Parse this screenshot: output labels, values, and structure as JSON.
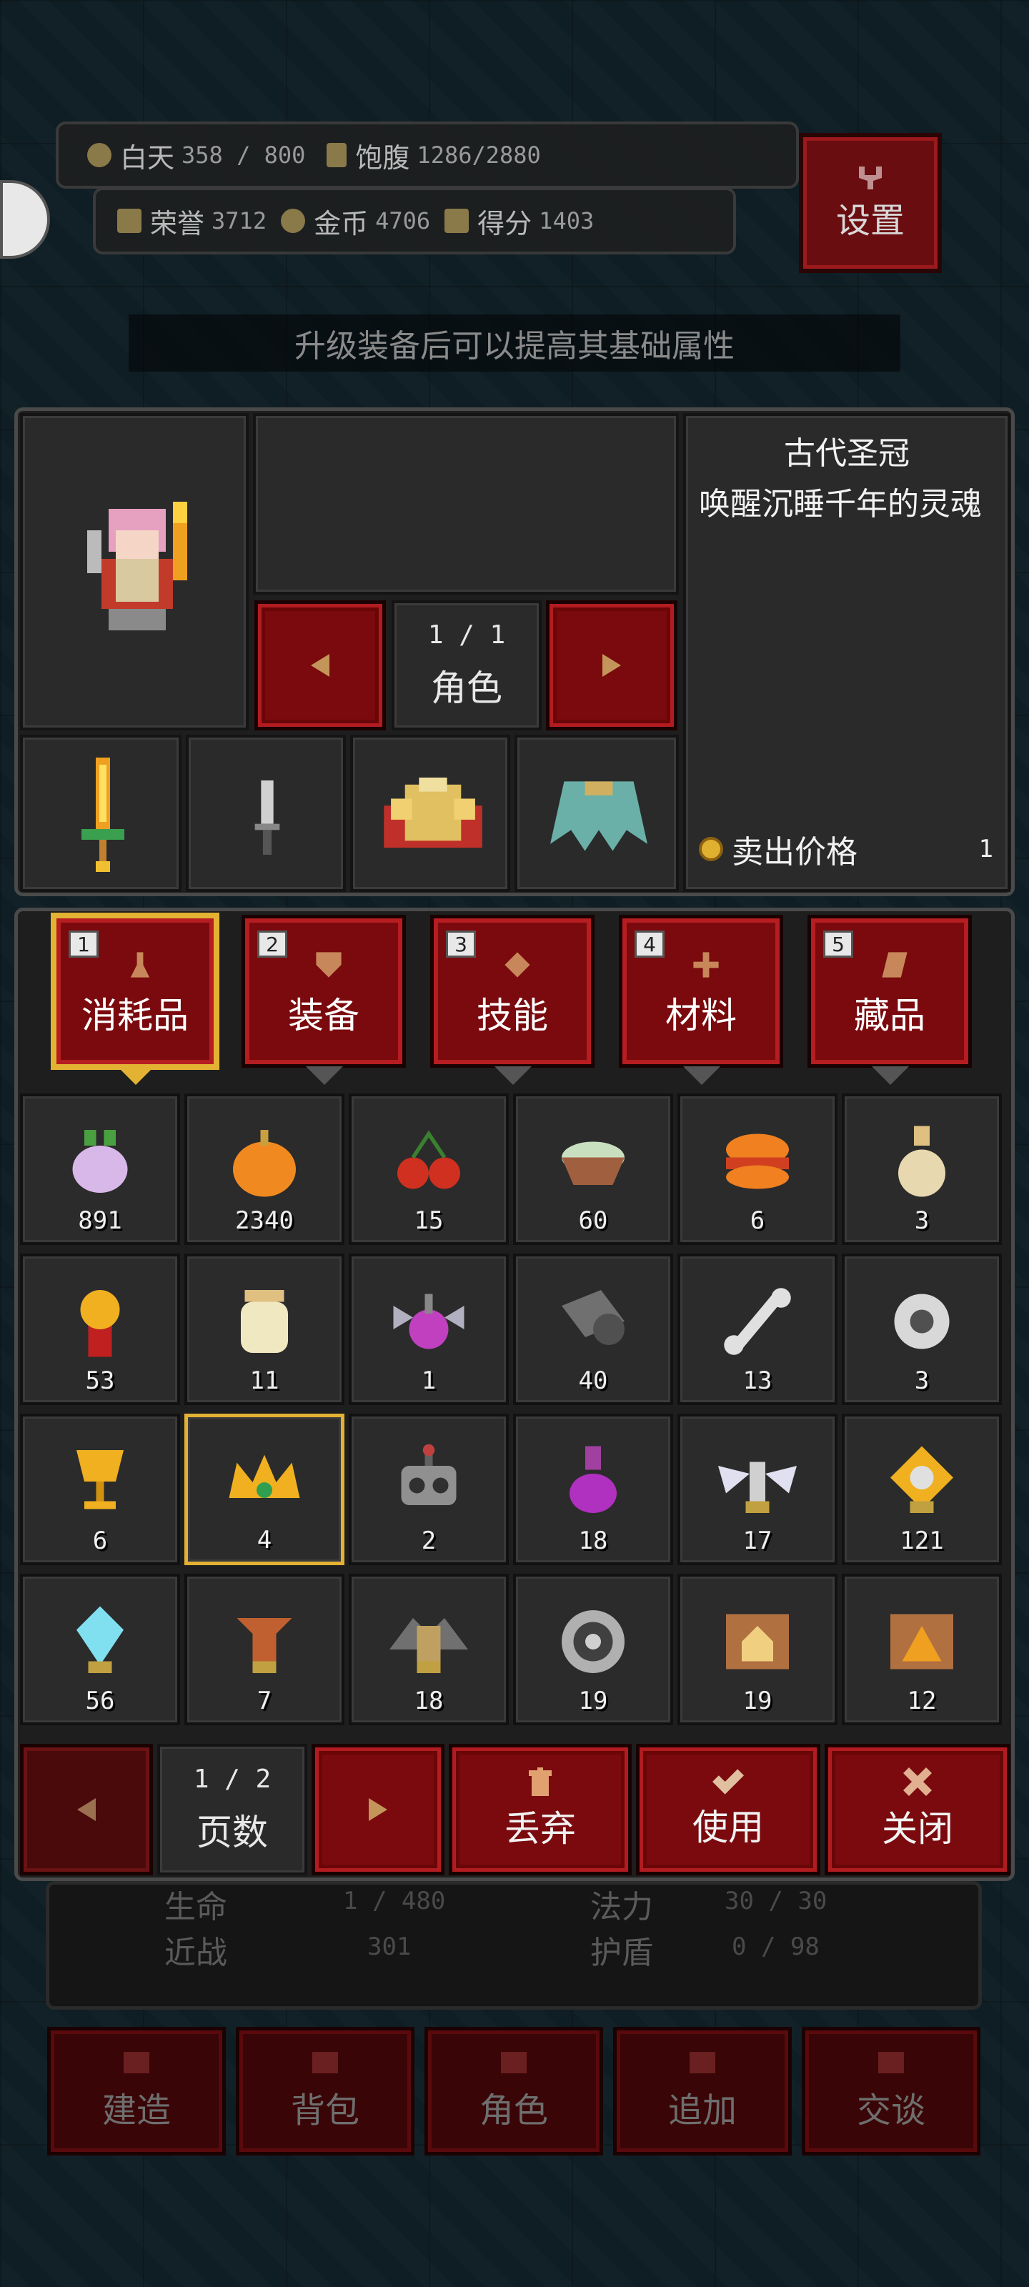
{
  "hud": {
    "day_label": "白天",
    "day_value": "358 / 800",
    "satiety_label": "饱腹",
    "satiety_value": "1286/2880",
    "honor_label": "荣誉",
    "honor_value": "3712",
    "gold_label": "金币",
    "gold_value": "4706",
    "score_label": "得分",
    "score_value": "1403",
    "settings_label": "设置"
  },
  "tip": "升级装备后可以提高其基础属性",
  "character": {
    "page": "1 / 1",
    "page_label": "角色"
  },
  "item_info": {
    "name": "古代圣冠",
    "description": "唤醒沉睡千年的灵魂",
    "sell_label": "卖出价格",
    "sell_value": "1"
  },
  "tabs": [
    {
      "num": "1",
      "label": "消耗品",
      "selected": true,
      "icon": "flask-icon"
    },
    {
      "num": "2",
      "label": "装备",
      "selected": false,
      "icon": "shield-icon"
    },
    {
      "num": "3",
      "label": "技能",
      "selected": false,
      "icon": "diamond-icon"
    },
    {
      "num": "4",
      "label": "材料",
      "selected": false,
      "icon": "cross-icon"
    },
    {
      "num": "5",
      "label": "藏品",
      "selected": false,
      "icon": "scroll-icon"
    }
  ],
  "items": [
    {
      "icon": "turnip-icon",
      "count": "891"
    },
    {
      "icon": "pumpkin-icon",
      "count": "2340"
    },
    {
      "icon": "cherry-icon",
      "count": "15"
    },
    {
      "icon": "soup-bowl-icon",
      "count": "60"
    },
    {
      "icon": "burger-icon",
      "count": "6"
    },
    {
      "icon": "potion-bottle-icon",
      "count": "3"
    },
    {
      "icon": "medal-icon",
      "count": "53"
    },
    {
      "icon": "jar-icon",
      "count": "11"
    },
    {
      "icon": "winged-potion-icon",
      "count": "1"
    },
    {
      "icon": "cloth-roll-icon",
      "count": "40"
    },
    {
      "icon": "bone-icon",
      "count": "13"
    },
    {
      "icon": "orb-icon",
      "count": "3"
    },
    {
      "icon": "goblet-icon",
      "count": "6"
    },
    {
      "icon": "crown-icon",
      "count": "4",
      "selected": true
    },
    {
      "icon": "robot-head-icon",
      "count": "2"
    },
    {
      "icon": "purple-potion-icon",
      "count": "18"
    },
    {
      "icon": "wing-relic-icon",
      "count": "17"
    },
    {
      "icon": "gold-relic-icon",
      "count": "121"
    },
    {
      "icon": "crystal-icon",
      "count": "56"
    },
    {
      "icon": "totem-icon",
      "count": "7"
    },
    {
      "icon": "bat-shrine-icon",
      "count": "18"
    },
    {
      "icon": "target-icon",
      "count": "19"
    },
    {
      "icon": "house-scroll-icon",
      "count": "19"
    },
    {
      "icon": "tent-scroll-icon",
      "count": "12"
    }
  ],
  "bottom": {
    "page": "1 / 2",
    "page_label": "页数",
    "discard_label": "丢弃",
    "use_label": "使用",
    "close_label": "关闭"
  },
  "stats": {
    "life_label": "生命",
    "life_value": "1 / 480",
    "mana_label": "法力",
    "mana_value": "30 / 30",
    "melee_label": "近战",
    "melee_value": "301",
    "shield_label": "护盾",
    "shield_value": "0 / 98"
  },
  "nav": [
    "建造",
    "背包",
    "角色",
    "追加",
    "交谈"
  ],
  "colors": {
    "accent_red": "#7a0a0e",
    "selected_gold": "#e3b233"
  }
}
